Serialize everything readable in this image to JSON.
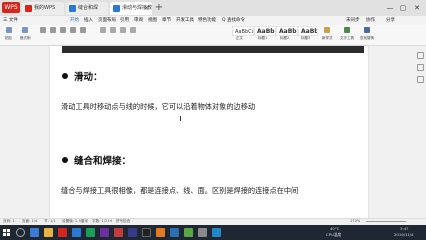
{
  "app": {
    "logo": "WPS"
  },
  "tabs": [
    {
      "label": "我的WPS",
      "color": "#d4261d"
    },
    {
      "label": "缝合和焊接.docx",
      "color": "#2b79d6"
    },
    {
      "label": "滑动与焊接教程.docx",
      "color": "#2b79d6"
    }
  ],
  "window_controls": {
    "minimize": "—",
    "maximize": "▢",
    "close": "✕"
  },
  "menu": {
    "file": "三 文件",
    "items": [
      "开始",
      "插入",
      "页面布局",
      "引用",
      "审阅",
      "视图",
      "章节",
      "开发工具",
      "特色功能"
    ],
    "search": "Q 查找命令",
    "sync": "未同步",
    "share": "协作",
    "share2": "分享"
  },
  "ribbon": {
    "labels": [
      "粘贴",
      "格式刷",
      "正文",
      "标题1",
      "标题2",
      "标题3",
      "新样式",
      "文字工具",
      "查找替换"
    ],
    "styles": [
      "AaBbCcDd",
      "AaBb(",
      "AaBb(",
      "AaBbC"
    ]
  },
  "document": {
    "section1_title": "滑动：",
    "section1_text": "滑动工具时移动点与线的时候，它可以沿着物体对象的边移动",
    "section2_title": "缝合和焊接：",
    "section2_text": "缝合与焊接工具很相像，都是连接点、线、面。区别是焊接的连接点在中间"
  },
  "statusbar": {
    "page": "页码: 1",
    "pages": "页面: 1/4",
    "section": "节: 1/1",
    "settings": "设置值: 2.5厘米",
    "words": "字数: 1/219",
    "spell": "拼写检查",
    "zoom": "170%"
  },
  "taskbar": {
    "weather": "40°C",
    "weather_label": "CPU温度",
    "time": "3:47",
    "date": "2019/11/4"
  }
}
